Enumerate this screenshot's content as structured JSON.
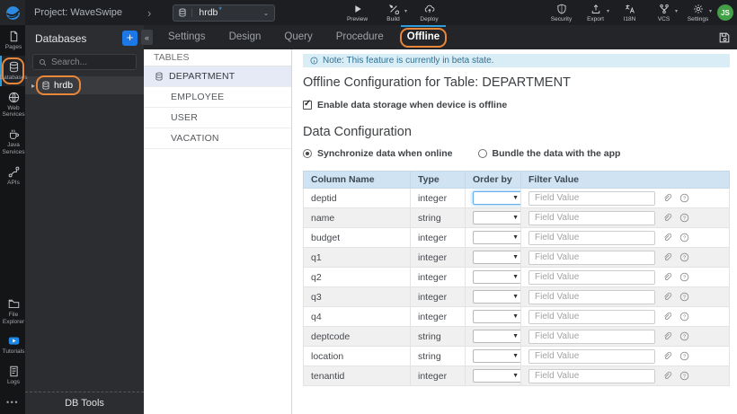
{
  "colors": {
    "annotation": "#e8863a",
    "accent": "#2d9cdb",
    "link_blue": "#41a4ff",
    "add_button": "#1d78e7",
    "tutorials_play": "#1e88e5",
    "avatar_bg": "#43a047",
    "note_bg": "#d9edf7",
    "note_text": "#31708f",
    "table_header_bg": "#cfe3f2",
    "selected_row_bg": "#e6e9f6",
    "focus_border": "#66afe9"
  },
  "topbar": {
    "project_label": "Project: WaveSwipe",
    "breadcrumb_glyph": "›",
    "db_selector": {
      "value": "hrdb",
      "modified_marker": "*"
    },
    "actions": [
      {
        "label": "Preview",
        "icon": "preview-icon",
        "caret": false
      },
      {
        "label": "Build",
        "icon": "build-icon",
        "caret": true
      },
      {
        "label": "Deploy",
        "icon": "deploy-icon",
        "caret": false
      }
    ],
    "right_actions": [
      {
        "label": "Security",
        "icon": "security-icon",
        "caret": false
      },
      {
        "label": "Export",
        "icon": "export-icon",
        "caret": true
      },
      {
        "label": "I18N",
        "icon": "i18n-icon",
        "caret": false
      },
      {
        "label": "VCS",
        "icon": "vcs-icon",
        "caret": true
      },
      {
        "label": "Settings",
        "icon": "settings-icon",
        "caret": true
      }
    ],
    "avatar": "JS"
  },
  "sidebar": {
    "top_items": [
      {
        "label": "Pages",
        "icon": "pages-icon",
        "active": false,
        "annotated": false
      },
      {
        "label": "Databases",
        "icon": "databases-icon",
        "active": true,
        "annotated": true
      },
      {
        "label": "Web Services",
        "icon": "web-services-icon",
        "active": false,
        "annotated": false
      },
      {
        "label": "Java Services",
        "icon": "java-services-icon",
        "active": false,
        "annotated": false
      },
      {
        "label": "APIs",
        "icon": "apis-icon",
        "active": false,
        "annotated": false
      }
    ],
    "bottom_items": [
      {
        "label": "File Explorer",
        "icon": "file-explorer-icon",
        "active": false,
        "annotated": false
      },
      {
        "label": "Tutorials",
        "icon": "tutorials-icon",
        "active": false,
        "annotated": false
      },
      {
        "label": "Logs",
        "icon": "logs-icon",
        "active": false,
        "annotated": false
      }
    ],
    "more_label": "•••"
  },
  "db_panel": {
    "title": "Databases",
    "add_button": "+",
    "search_placeholder": "Search...",
    "items": [
      {
        "label": "hrdb",
        "icon": "database-icon",
        "annotated": true
      }
    ],
    "footer": "DB Tools"
  },
  "tabbar": {
    "collapse_glyph": "«",
    "tabs": [
      {
        "label": "Settings",
        "active": false,
        "annotated": false
      },
      {
        "label": "Design",
        "active": false,
        "annotated": false
      },
      {
        "label": "Query",
        "active": false,
        "annotated": false
      },
      {
        "label": "Procedure",
        "active": false,
        "annotated": false
      },
      {
        "label": "Offline",
        "active": true,
        "annotated": true
      }
    ]
  },
  "tables_panel": {
    "title": "TABLES",
    "items": [
      {
        "label": "DEPARTMENT",
        "icon": "table-icon",
        "selected": true
      },
      {
        "label": "EMPLOYEE",
        "selected": false
      },
      {
        "label": "USER",
        "selected": false
      },
      {
        "label": "VACATION",
        "selected": false
      }
    ]
  },
  "offline_config": {
    "note": "Note: This feature is currently in beta state.",
    "title": "Offline Configuration for Table: DEPARTMENT",
    "enable_storage": {
      "label": "Enable data storage when device is offline",
      "checked": true
    },
    "section_title": "Data Configuration",
    "sync_options": [
      {
        "label": "Synchronize data when online",
        "selected": true
      },
      {
        "label": "Bundle the data with the app",
        "selected": false
      }
    ],
    "table": {
      "headers": [
        "Column Name",
        "Type",
        "Order by",
        "Filter Value"
      ],
      "filter_placeholder": "Field Value",
      "rows": [
        {
          "column": "deptid",
          "type": "integer",
          "order_by": "",
          "filter_value": "",
          "focused": true
        },
        {
          "column": "name",
          "type": "string",
          "order_by": "",
          "filter_value": "",
          "focused": false
        },
        {
          "column": "budget",
          "type": "integer",
          "order_by": "",
          "filter_value": "",
          "focused": false
        },
        {
          "column": "q1",
          "type": "integer",
          "order_by": "",
          "filter_value": "",
          "focused": false
        },
        {
          "column": "q2",
          "type": "integer",
          "order_by": "",
          "filter_value": "",
          "focused": false
        },
        {
          "column": "q3",
          "type": "integer",
          "order_by": "",
          "filter_value": "",
          "focused": false
        },
        {
          "column": "q4",
          "type": "integer",
          "order_by": "",
          "filter_value": "",
          "focused": false
        },
        {
          "column": "deptcode",
          "type": "string",
          "order_by": "",
          "filter_value": "",
          "focused": false
        },
        {
          "column": "location",
          "type": "string",
          "order_by": "",
          "filter_value": "",
          "focused": false
        },
        {
          "column": "tenantid",
          "type": "integer",
          "order_by": "",
          "filter_value": "",
          "focused": false
        }
      ]
    }
  }
}
